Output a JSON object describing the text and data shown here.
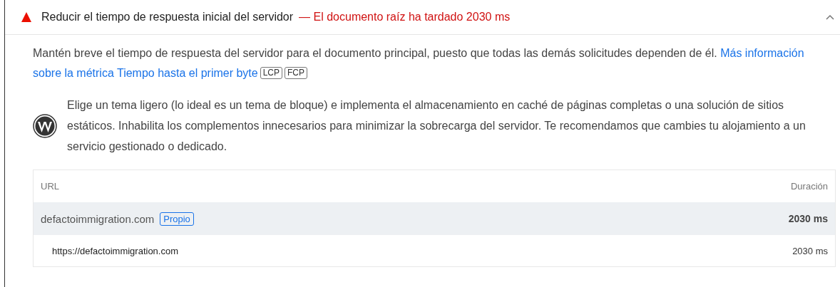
{
  "audit": {
    "title": "Reducir el tiempo de respuesta inicial del servidor",
    "display_value": "— El documento raíz ha tardado 2030 ms",
    "expanded": true
  },
  "description": {
    "text": "Mantén breve el tiempo de respuesta del servidor para el documento principal, puesto que todas las demás solicitudes dependen de él.",
    "link": "Más información sobre la métrica Tiempo hasta el primer byte",
    "tags": [
      "LCP",
      "FCP"
    ]
  },
  "stack_pack": {
    "text": "Elige un tema ligero (lo ideal es un tema de bloque) e implementa el almacenamiento en caché de páginas completas o una solución de sitios estáticos. Inhabilita los complementos innecesarios para minimizar la sobrecarga del servidor. Te recomendamos que cambies tu alojamiento a un servicio gestionado o dedicado."
  },
  "table": {
    "columns": [
      "URL",
      "Duración"
    ],
    "rows": [
      {
        "kind": "group",
        "url": "defactoimmigration.com",
        "badge": "Propio",
        "duration": "2030 ms"
      },
      {
        "kind": "item",
        "url": "https://defactoimmigration.com",
        "duration": "2030 ms"
      }
    ]
  }
}
